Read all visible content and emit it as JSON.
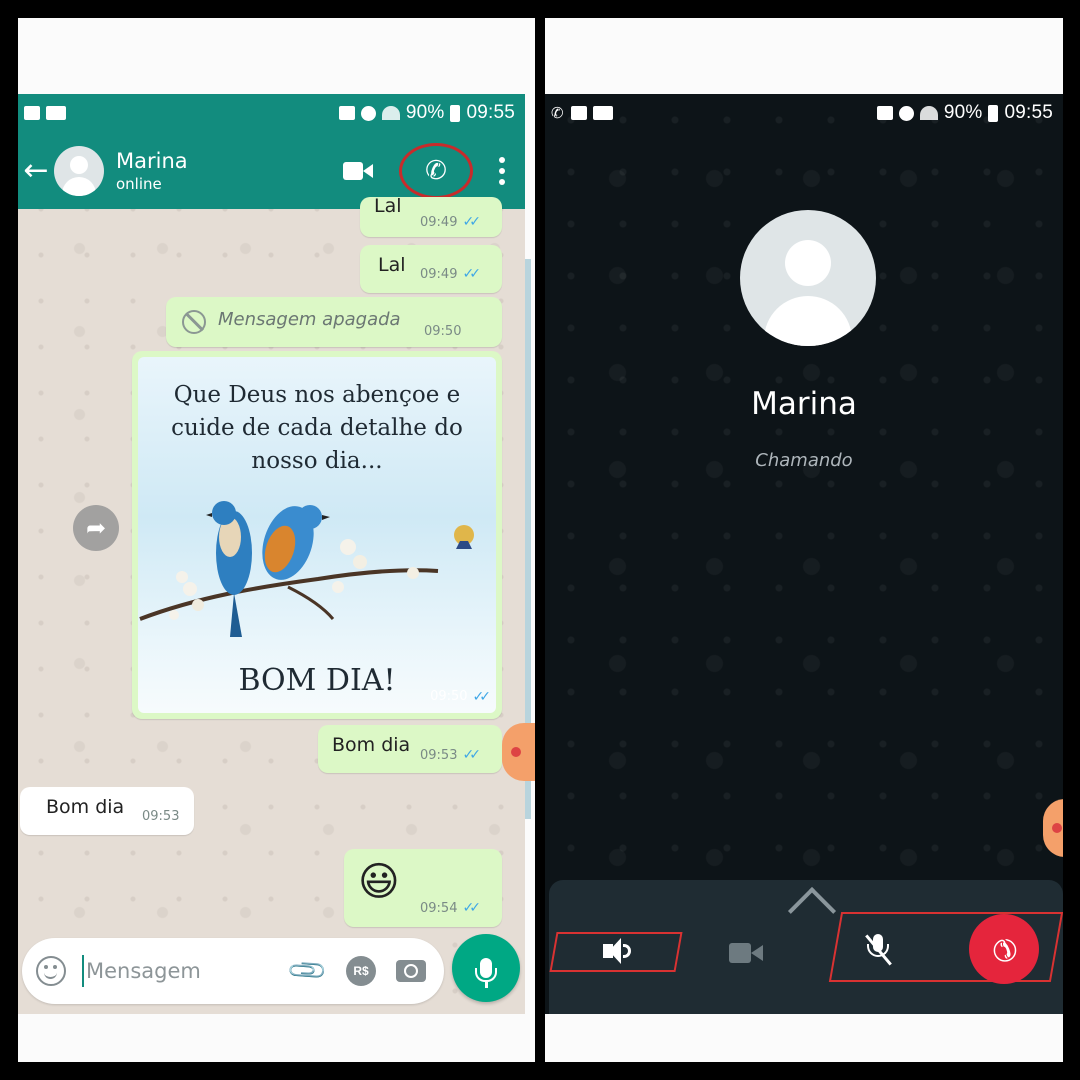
{
  "status_bar": {
    "battery": "90%",
    "time": "09:55"
  },
  "chat": {
    "contact_name": "Marina",
    "contact_status": "online",
    "messages": [
      {
        "text": "Lal",
        "time": "09:49"
      },
      {
        "text": "Lal",
        "time": "09:49"
      },
      {
        "text": "Mensagem apagada",
        "time": "09:50"
      },
      {
        "image_text": "Que Deus nos abençoe e cuide de cada detalhe do nosso dia...",
        "image_footer": "BOM DIA!",
        "time": "09:50"
      },
      {
        "text": "Bom dia",
        "time": "09:53"
      },
      {
        "text": "Bom dia",
        "time": "09:53"
      },
      {
        "text": "😃",
        "time": "09:54"
      }
    ],
    "input_placeholder": "Mensagem",
    "rs_label": "R$"
  },
  "call": {
    "callee_name": "Marina",
    "call_status": "Chamando"
  },
  "colors": {
    "header_green": "#128c7e",
    "outgoing_bubble": "#dcf8c6",
    "call_background": "#0d1418",
    "end_call_red": "#e5253c",
    "highlight_red": "#c82b2b"
  },
  "icons": [
    "back-arrow-icon",
    "video-call-icon",
    "voice-call-icon",
    "menu-icon",
    "deleted-icon",
    "forward-icon",
    "emoji-icon",
    "attach-icon",
    "camera-icon",
    "mic-icon",
    "speaker-icon",
    "video-off-icon",
    "mute-icon",
    "end-call-icon",
    "chevron-up-icon"
  ]
}
